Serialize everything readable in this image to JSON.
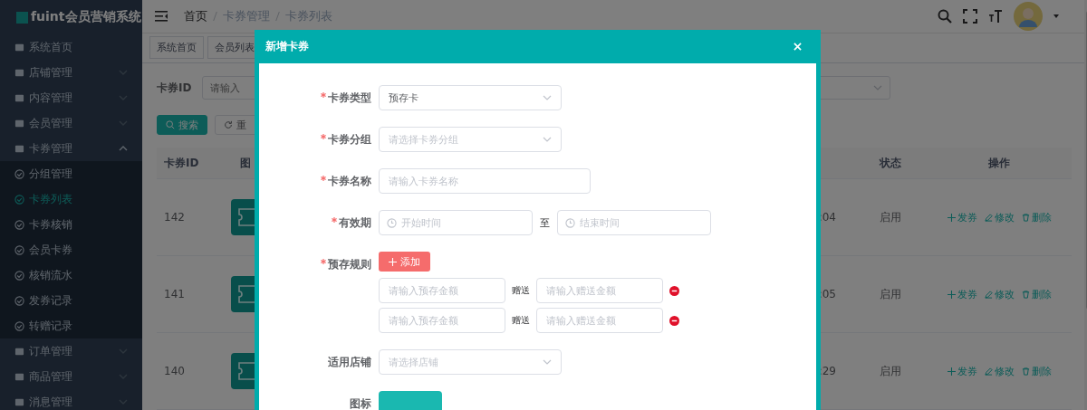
{
  "sidebar": {
    "logo": "fuint会员营销系统",
    "items": [
      {
        "label": "系统首页"
      },
      {
        "label": "店铺管理",
        "expanded": false
      },
      {
        "label": "内容管理",
        "expanded": false
      },
      {
        "label": "会员管理",
        "expanded": false
      },
      {
        "label": "卡券管理",
        "expanded": true,
        "children": [
          {
            "label": "分组管理",
            "selected": false
          },
          {
            "label": "卡券列表",
            "selected": true
          },
          {
            "label": "卡券核销",
            "selected": false
          },
          {
            "label": "会员卡券",
            "selected": false
          },
          {
            "label": "核销流水",
            "selected": false
          },
          {
            "label": "发券记录",
            "selected": false
          },
          {
            "label": "转赠记录",
            "selected": false
          }
        ]
      },
      {
        "label": "订单管理",
        "expanded": false
      },
      {
        "label": "商品管理",
        "expanded": false
      },
      {
        "label": "消息管理",
        "expanded": false
      }
    ]
  },
  "breadcrumb": [
    "首页",
    "卡券管理",
    "卡券列表"
  ],
  "tabs": [
    {
      "label": "系统首页",
      "selected": false
    },
    {
      "label": "会员列表",
      "selected": false
    }
  ],
  "search": {
    "label": "卡券ID",
    "placeholder": "请输入"
  },
  "search_buttons": [
    "搜索",
    "重"
  ],
  "table": {
    "columns": [
      "卡券ID",
      "图",
      "状态",
      "操作"
    ],
    "rows": [
      {
        "id": "142",
        "time": ":04",
        "status": "启用",
        "actions": [
          "发券",
          "修改",
          "删除"
        ]
      },
      {
        "id": "141",
        "time": ":05",
        "status": "启用",
        "actions": [
          "发券",
          "修改",
          "删除"
        ]
      },
      {
        "id": "140",
        "time": ":29",
        "status": "启用",
        "actions": [
          "发券",
          "修改",
          "删除"
        ]
      }
    ]
  },
  "dialog": {
    "title": "新增卡券",
    "fields": [
      {
        "kind": "select",
        "label": "卡券类型",
        "required": true,
        "value": "预存卡"
      },
      {
        "kind": "select",
        "label": "卡券分组",
        "required": true,
        "placeholder": "请选择卡券分组"
      },
      {
        "kind": "text",
        "label": "卡券名称",
        "required": true,
        "placeholder": "请输入卡券名称"
      },
      {
        "kind": "daterange",
        "label": "有效期",
        "required": true,
        "start_placeholder": "开始时间",
        "separator": "至",
        "end_placeholder": "结束时间"
      },
      {
        "kind": "rules",
        "label": "预存规则",
        "required": true,
        "add_label": "添加",
        "rows": [
          {
            "amount_placeholder": "请输入预存金额",
            "gift_label": "赠送",
            "gift_placeholder": "请输入赠送金额"
          },
          {
            "amount_placeholder": "请输入预存金额",
            "gift_label": "赠送",
            "gift_placeholder": "请输入赠送金额"
          }
        ]
      },
      {
        "kind": "select",
        "label": "适用店铺",
        "required": false,
        "placeholder": "请选择店铺"
      },
      {
        "kind": "upload",
        "label": "图标",
        "required": false
      }
    ]
  }
}
